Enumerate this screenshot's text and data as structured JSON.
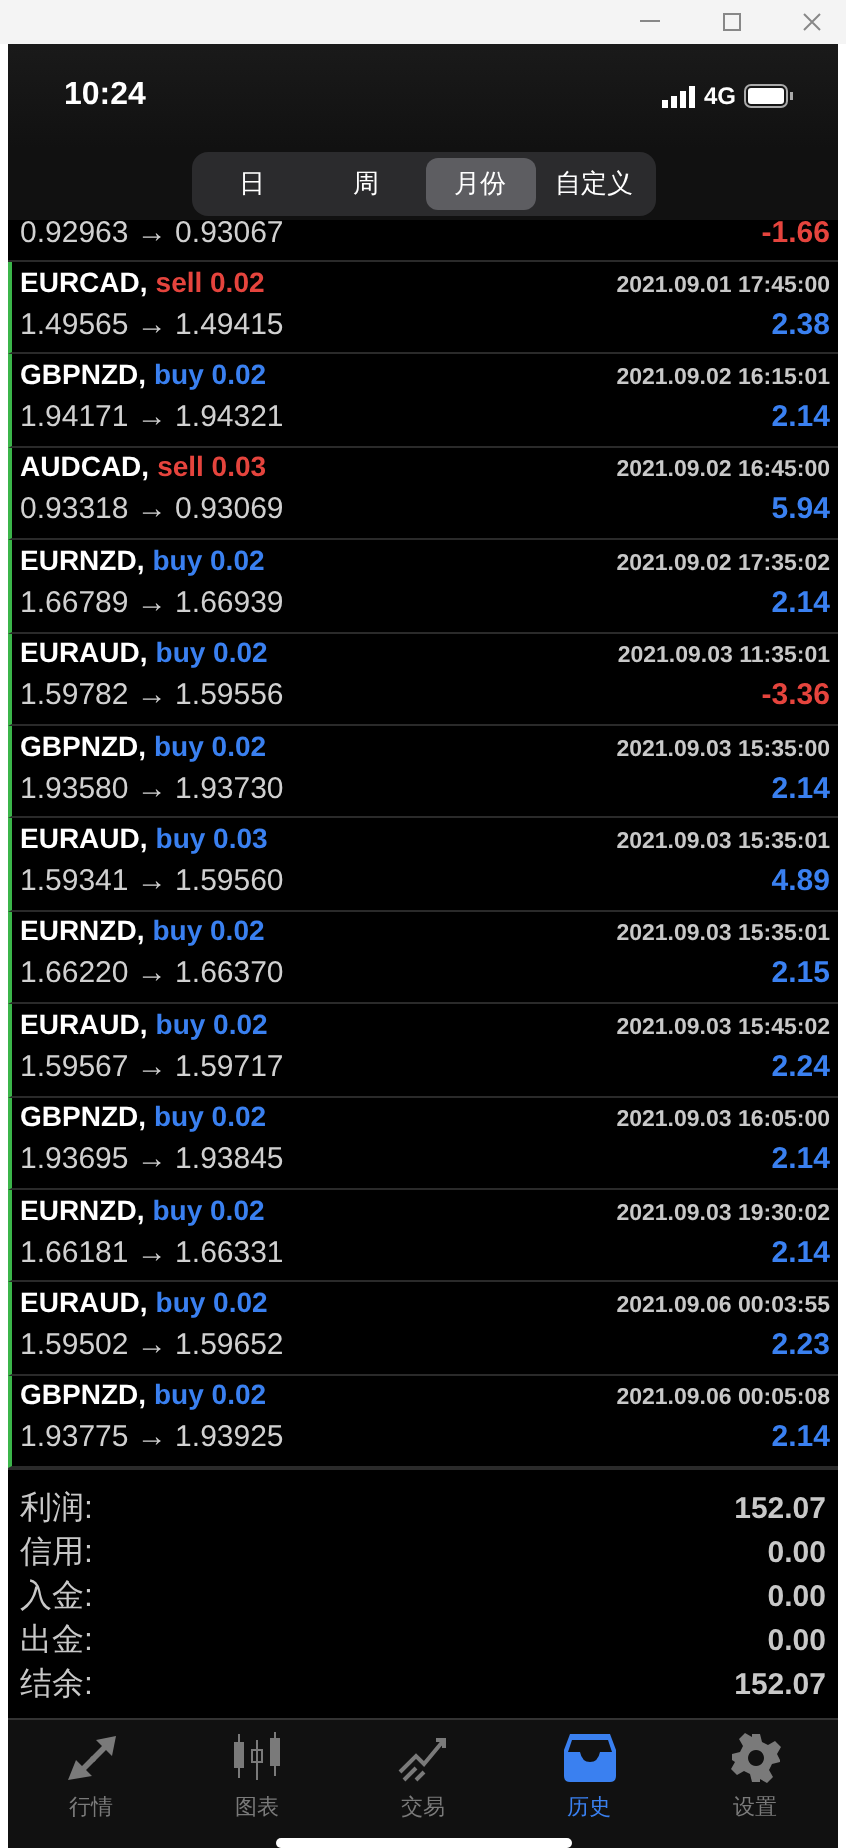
{
  "status_bar": {
    "time": "10:24",
    "network": "4G"
  },
  "tabs": [
    {
      "label": "日",
      "selected": false
    },
    {
      "label": "周",
      "selected": false
    },
    {
      "label": "月份",
      "selected": true
    },
    {
      "label": "自定义",
      "selected": false
    }
  ],
  "partial_row": {
    "prices": "0.92963 → 0.93067",
    "profit": "-1.66",
    "negative": true
  },
  "deals": [
    {
      "symbol": "EURCAD,",
      "order": "sell 0.02",
      "kind": "sell",
      "time": "2021.09.01 17:45:00",
      "prices": "1.49565 → 1.49415",
      "profit": "2.38",
      "negative": false
    },
    {
      "symbol": "GBPNZD,",
      "order": "buy 0.02",
      "kind": "buy",
      "time": "2021.09.02 16:15:01",
      "prices": "1.94171 → 1.94321",
      "profit": "2.14",
      "negative": false
    },
    {
      "symbol": "AUDCAD,",
      "order": "sell 0.03",
      "kind": "sell",
      "time": "2021.09.02 16:45:00",
      "prices": "0.93318 → 0.93069",
      "profit": "5.94",
      "negative": false
    },
    {
      "symbol": "EURNZD,",
      "order": "buy 0.02",
      "kind": "buy",
      "time": "2021.09.02 17:35:02",
      "prices": "1.66789 → 1.66939",
      "profit": "2.14",
      "negative": false
    },
    {
      "symbol": "EURAUD,",
      "order": "buy 0.02",
      "kind": "buy",
      "time": "2021.09.03 11:35:01",
      "prices": "1.59782 → 1.59556",
      "profit": "-3.36",
      "negative": true
    },
    {
      "symbol": "GBPNZD,",
      "order": "buy 0.02",
      "kind": "buy",
      "time": "2021.09.03 15:35:00",
      "prices": "1.93580 → 1.93730",
      "profit": "2.14",
      "negative": false
    },
    {
      "symbol": "EURAUD,",
      "order": "buy 0.03",
      "kind": "buy",
      "time": "2021.09.03 15:35:01",
      "prices": "1.59341 → 1.59560",
      "profit": "4.89",
      "negative": false
    },
    {
      "symbol": "EURNZD,",
      "order": "buy 0.02",
      "kind": "buy",
      "time": "2021.09.03 15:35:01",
      "prices": "1.66220 → 1.66370",
      "profit": "2.15",
      "negative": false
    },
    {
      "symbol": "EURAUD,",
      "order": "buy 0.02",
      "kind": "buy",
      "time": "2021.09.03 15:45:02",
      "prices": "1.59567 → 1.59717",
      "profit": "2.24",
      "negative": false
    },
    {
      "symbol": "GBPNZD,",
      "order": "buy 0.02",
      "kind": "buy",
      "time": "2021.09.03 16:05:00",
      "prices": "1.93695 → 1.93845",
      "profit": "2.14",
      "negative": false
    },
    {
      "symbol": "EURNZD,",
      "order": "buy 0.02",
      "kind": "buy",
      "time": "2021.09.03 19:30:02",
      "prices": "1.66181 → 1.66331",
      "profit": "2.14",
      "negative": false
    },
    {
      "symbol": "EURAUD,",
      "order": "buy 0.02",
      "kind": "buy",
      "time": "2021.09.06 00:03:55",
      "prices": "1.59502 → 1.59652",
      "profit": "2.23",
      "negative": false
    },
    {
      "symbol": "GBPNZD,",
      "order": "buy 0.02",
      "kind": "buy",
      "time": "2021.09.06 00:05:08",
      "prices": "1.93775 → 1.93925",
      "profit": "2.14",
      "negative": false
    }
  ],
  "summary": [
    {
      "label": "利润:",
      "value": "152.07"
    },
    {
      "label": "信用:",
      "value": "0.00"
    },
    {
      "label": "入金:",
      "value": "0.00"
    },
    {
      "label": "出金:",
      "value": "0.00"
    },
    {
      "label": "结余:",
      "value": "152.07"
    }
  ],
  "nav": [
    {
      "kind": "quotes",
      "label": "行情",
      "selected": false
    },
    {
      "kind": "chart",
      "label": "图表",
      "selected": false
    },
    {
      "kind": "trade",
      "label": "交易",
      "selected": false
    },
    {
      "kind": "history",
      "label": "历史",
      "selected": true
    },
    {
      "kind": "settings",
      "label": "设置",
      "selected": false
    }
  ]
}
